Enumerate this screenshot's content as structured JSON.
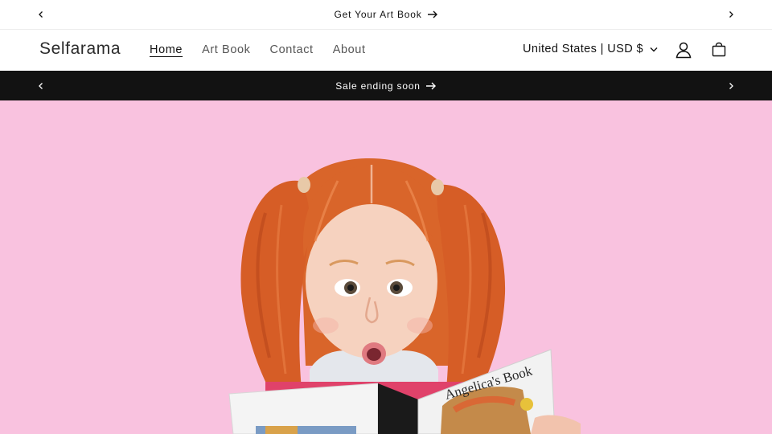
{
  "announcement_top": {
    "text": "Get Your Art Book"
  },
  "header": {
    "logo": "Selfarama",
    "nav": [
      {
        "label": "Home",
        "active": true
      },
      {
        "label": "Art Book",
        "active": false
      },
      {
        "label": "Contact",
        "active": false
      },
      {
        "label": "About",
        "active": false
      }
    ],
    "locale": "United States | USD $"
  },
  "announcement_sale": {
    "text": "Sale ending soon"
  },
  "hero": {
    "book_title": "Angelica's Book",
    "background_color": "#f9c2df"
  },
  "colors": {
    "dark_bar": "#121212",
    "text": "#121212"
  }
}
